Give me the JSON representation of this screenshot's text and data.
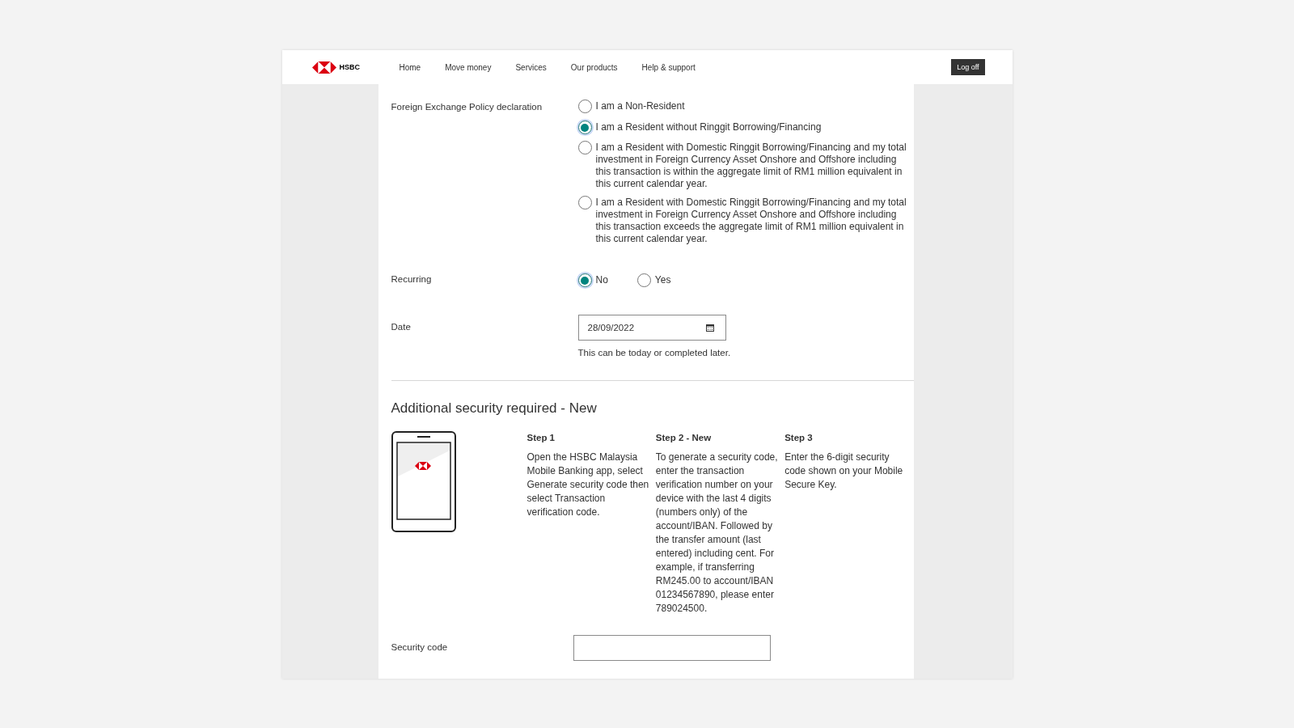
{
  "header": {
    "logo_text": "HSBC",
    "nav": [
      {
        "label": "Home"
      },
      {
        "label": "Move money"
      },
      {
        "label": "Services"
      },
      {
        "label": "Our products"
      },
      {
        "label": "Help & support"
      }
    ],
    "logoff": "Log off"
  },
  "fx_policy": {
    "label": "Foreign Exchange Policy declaration",
    "options": [
      {
        "label": "I am a Non-Resident",
        "selected": false
      },
      {
        "label": "I am a Resident without Ringgit Borrowing/Financing",
        "selected": true
      },
      {
        "label": "I am a Resident with Domestic Ringgit Borrowing/Financing and my total investment in Foreign Currency Asset Onshore and Offshore including this transaction is within the aggregate limit of RM1 million equivalent in this current calendar year.",
        "selected": false
      },
      {
        "label": "I am a Resident with Domestic Ringgit Borrowing/Financing and my total investment in Foreign Currency Asset Onshore and Offshore including this transaction exceeds the aggregate limit of RM1 million equivalent in this current calendar year.",
        "selected": false
      }
    ]
  },
  "recurring": {
    "label": "Recurring",
    "options": [
      {
        "label": "No",
        "selected": true
      },
      {
        "label": "Yes",
        "selected": false
      }
    ]
  },
  "date": {
    "label": "Date",
    "value": "28/09/2022",
    "hint": "This can be today or completed later."
  },
  "security": {
    "title": "Additional security required - New",
    "steps": [
      {
        "title": "Step 1",
        "text": "Open the HSBC Malaysia Mobile Banking app, select Generate security code then select Transaction verification code."
      },
      {
        "title": "Step 2 - New",
        "text": "To generate a security code, enter the transaction verification number on your device with the last 4 digits (numbers only) of the account/IBAN. Followed by the transfer amount (last entered) including cent. For example, if transferring RM245.00 to account/IBAN 01234567890, please enter 789024500."
      },
      {
        "title": "Step 3",
        "text": "Enter the 6-digit security code shown on your Mobile Secure Key."
      }
    ],
    "code_label": "Security code"
  }
}
